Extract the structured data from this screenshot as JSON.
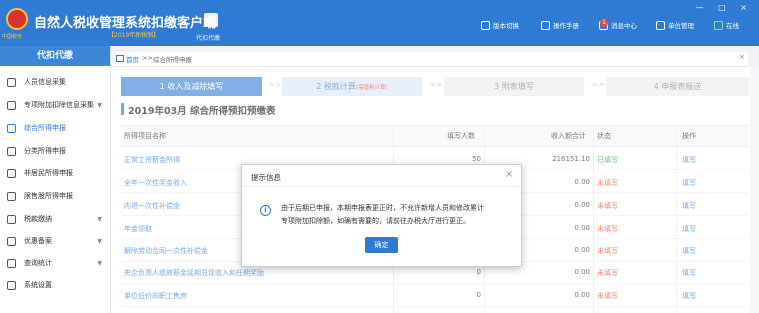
{
  "header": {
    "app_title": "自然人税收管理系统扣缴客户端",
    "version": "【2019年新税制】",
    "logo_caption": "中国税务",
    "doc_label": "代扣代缴",
    "buttons": [
      {
        "label": "版本切换",
        "icon": "switch-icon"
      },
      {
        "label": "操作手册",
        "icon": "manual-icon"
      },
      {
        "label": "消息中心",
        "icon": "message-icon"
      },
      {
        "label": "单位管理",
        "icon": "building-icon"
      },
      {
        "label": "在线",
        "icon": "online-icon"
      }
    ],
    "message_badge": "1",
    "window_controls": "— □ ×"
  },
  "sidebar": {
    "title": "代扣代缴",
    "items": [
      {
        "label": "人员信息采集",
        "icon": "person-icon",
        "arrow": ""
      },
      {
        "label": "专项附加扣除信息采集",
        "icon": "list-icon",
        "arrow": "▼"
      },
      {
        "label": "综合所得申报",
        "icon": "layers-icon",
        "arrow": ""
      },
      {
        "label": "分类所得申报",
        "icon": "person-icon",
        "arrow": ""
      },
      {
        "label": "非居民所得申报",
        "icon": "person-icon",
        "arrow": ""
      },
      {
        "label": "限售股所得申报",
        "icon": "stock-icon",
        "arrow": ""
      },
      {
        "label": "税款缴纳",
        "icon": "tax-icon",
        "arrow": "▼"
      },
      {
        "label": "优惠备案",
        "icon": "gift-icon",
        "arrow": "▼"
      },
      {
        "label": "查询统计",
        "icon": "search-icon",
        "arrow": "▼"
      },
      {
        "label": "系统设置",
        "icon": "gear-icon",
        "arrow": ""
      }
    ]
  },
  "breadcrumb": {
    "home": "首页",
    "sep": ">>",
    "current": "综合所得申报"
  },
  "steps": [
    {
      "label": "1 收入及减除填写",
      "sub": ""
    },
    {
      "label": "2 税款计算",
      "sub": "(需重新计算)"
    },
    {
      "label": "3 附表填写",
      "sub": ""
    },
    {
      "label": "4 申报表报送",
      "sub": ""
    }
  ],
  "step_arrow": ">>",
  "period_title": "2019年03月  综合所得预扣预缴表",
  "table": {
    "headers": [
      "所得项目名称",
      "填写人数",
      "收入额合计",
      "状态",
      "操作"
    ],
    "rows": [
      {
        "name": "正常工资薪金所得",
        "count": "50",
        "amount": "216151.10",
        "status": "已填写",
        "status_color": "#19a33b",
        "op": "填写"
      },
      {
        "name": "全年一次性奖金收入",
        "count": "",
        "amount": "0.00",
        "status": "未填写",
        "status_color": "#e8492b",
        "op": "填写"
      },
      {
        "name": "内退一次性补偿金",
        "count": "",
        "amount": "0.00",
        "status": "未填写",
        "status_color": "#e8492b",
        "op": "填写"
      },
      {
        "name": "年金领取",
        "count": "",
        "amount": "0.00",
        "status": "未填写",
        "status_color": "#e8492b",
        "op": "填写"
      },
      {
        "name": "解除劳动合同一次性补偿金",
        "count": "",
        "amount": "0.00",
        "status": "未填写",
        "status_color": "#e8492b",
        "op": "填写"
      },
      {
        "name": "央企负责人绩效薪金延期兑现收入和任期奖励",
        "count": "0",
        "amount": "0.00",
        "status": "未填写",
        "status_color": "#e8492b",
        "op": "填写"
      },
      {
        "name": "单位低价向职工售房",
        "count": "0",
        "amount": "0.00",
        "status": "未填写",
        "status_color": "#e8492b",
        "op": "填写"
      },
      {
        "name": "",
        "count": "",
        "amount": "",
        "status": "",
        "status_color": "#e8492b",
        "op": ""
      }
    ]
  },
  "dialog": {
    "title": "提示信息",
    "message_line1": "由于后期已申报，本期申报表更正时，不允许新增人员和修改累计",
    "message_line2": "专项附加扣除额，如确有需要的，请前往办税大厅进行更正。",
    "ok_label": "确定",
    "close": "×",
    "info_glyph": "i"
  },
  "colors": {
    "brand": "#2f7ad3",
    "filled": "#19a33b",
    "unfilled": "#e8492b"
  }
}
